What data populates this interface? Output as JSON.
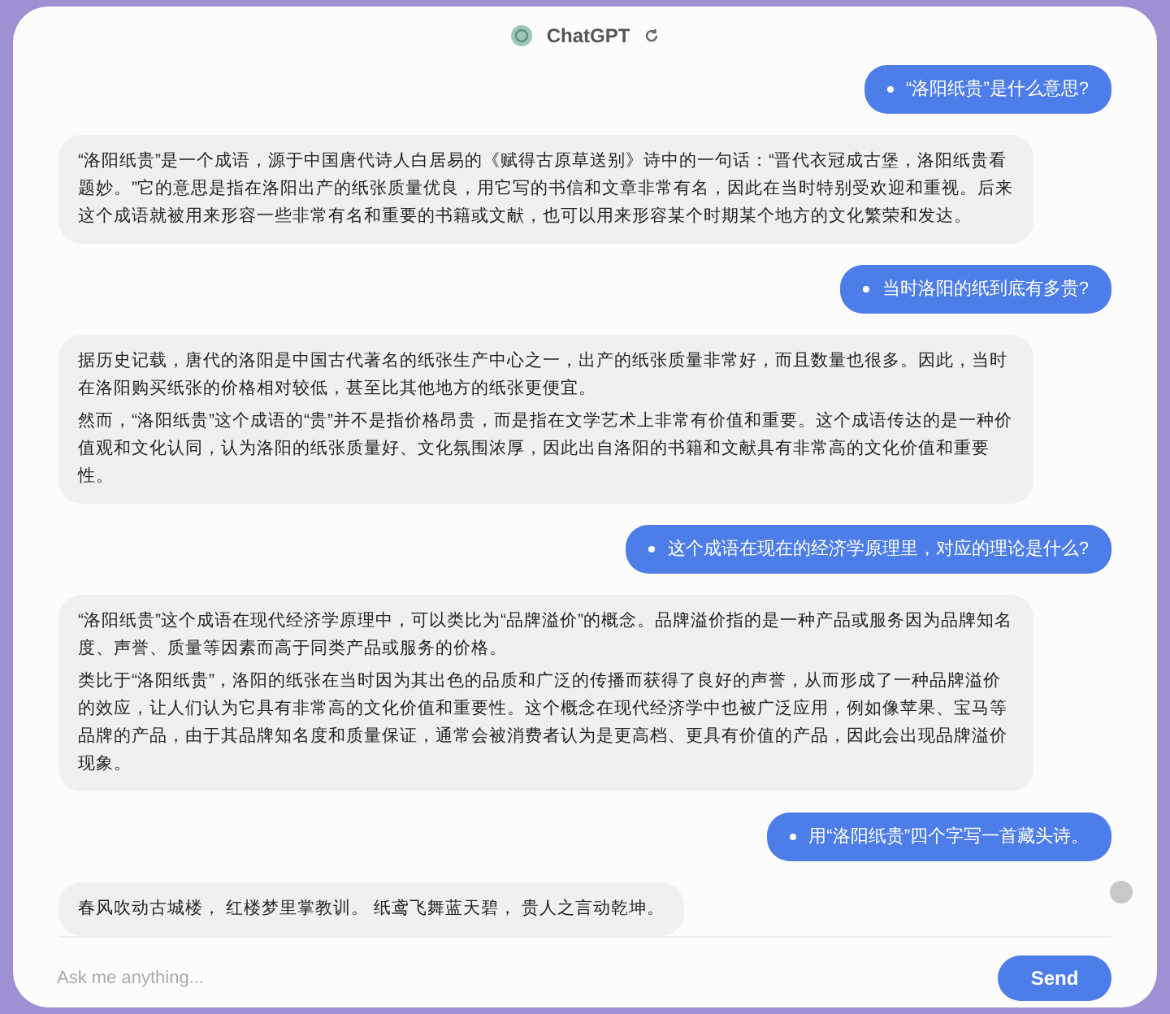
{
  "header": {
    "title": "ChatGPT"
  },
  "messages": [
    {
      "kind": "user",
      "paragraphs": [
        "“洛阳纸贵”是什么意思?"
      ]
    },
    {
      "kind": "assistant",
      "paragraphs": [
        "“洛阳纸贵”是一个成语，源于中国唐代诗人白居易的《赋得古原草送别》诗中的一句话：“晋代衣冠成古堡，洛阳纸贵看题妙。”它的意思是指在洛阳出产的纸张质量优良，用它写的书信和文章非常有名，因此在当时特别受欢迎和重视。后来这个成语就被用来形容一些非常有名和重要的书籍或文献，也可以用来形容某个时期某个地方的文化繁荣和发达。"
      ]
    },
    {
      "kind": "user",
      "paragraphs": [
        "当时洛阳的纸到底有多贵?"
      ]
    },
    {
      "kind": "assistant",
      "paragraphs": [
        "据历史记载，唐代的洛阳是中国古代著名的纸张生产中心之一，出产的纸张质量非常好，而且数量也很多。因此，当时在洛阳购买纸张的价格相对较低，甚至比其他地方的纸张更便宜。",
        "然而，“洛阳纸贵”这个成语的“贵”并不是指价格昂贵，而是指在文学艺术上非常有价值和重要。这个成语传达的是一种价值观和文化认同，认为洛阳的纸张质量好、文化氛围浓厚，因此出自洛阳的书籍和文献具有非常高的文化价值和重要性。"
      ]
    },
    {
      "kind": "user",
      "paragraphs": [
        "这个成语在现在的经济学原理里，对应的理论是什么?"
      ]
    },
    {
      "kind": "assistant",
      "paragraphs": [
        "“洛阳纸贵”这个成语在现代经济学原理中，可以类比为“品牌溢价”的概念。品牌溢价指的是一种产品或服务因为品牌知名度、声誉、质量等因素而高于同类产品或服务的价格。",
        "类比于“洛阳纸贵”，洛阳的纸张在当时因为其出色的品质和广泛的传播而获得了良好的声誉，从而形成了一种品牌溢价的效应，让人们认为它具有非常高的文化价值和重要性。这个概念在现代经济学中也被广泛应用，例如像苹果、宝马等品牌的产品，由于其品牌知名度和质量保证，通常会被消费者认为是更高档、更具有价值的产品，因此会出现品牌溢价现象。"
      ]
    },
    {
      "kind": "user",
      "paragraphs": [
        "用“洛阳纸贵”四个字写一首藏头诗。"
      ]
    },
    {
      "kind": "assistant",
      "paragraphs": [
        "春风吹动古城楼， 红楼梦里掌教训。 纸鸢飞舞蓝天碧， 贵人之言动乾坤。"
      ]
    }
  ],
  "composer": {
    "placeholder": "Ask me anything...",
    "send_label": "Send"
  }
}
